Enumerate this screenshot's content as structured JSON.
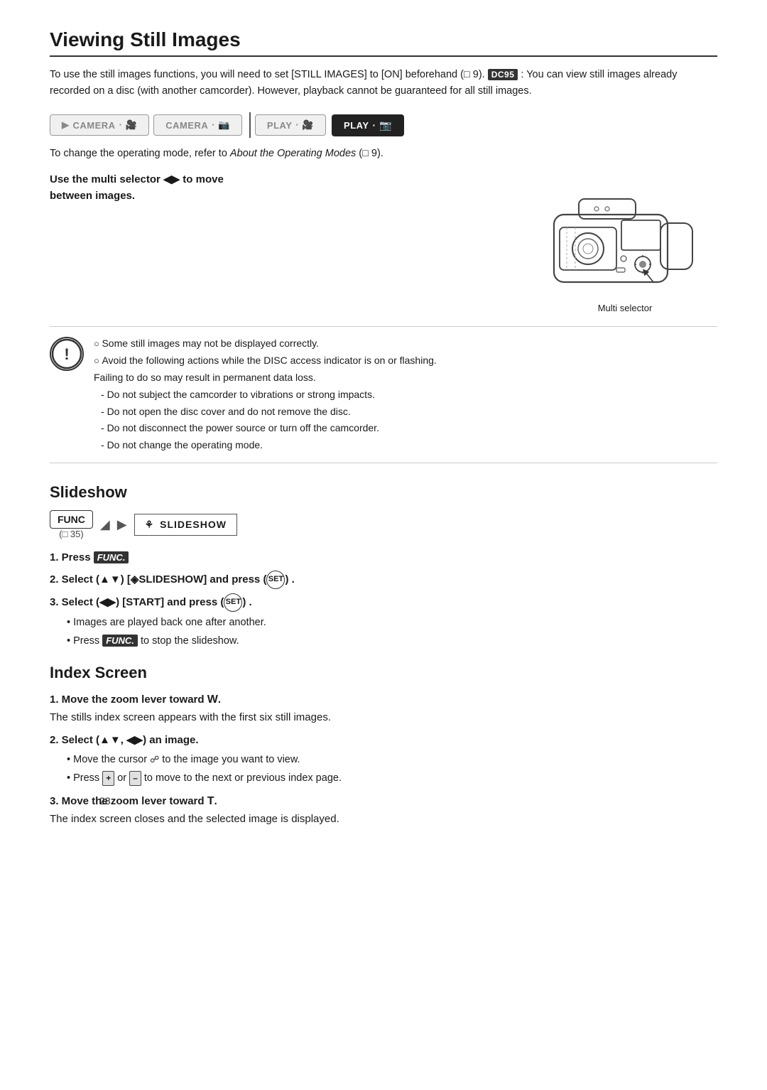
{
  "page": {
    "title": "Viewing Still Images",
    "page_number": "28"
  },
  "intro": {
    "text1": "To use the still images functions, you will need to set [STILL IMAGES] to [ON] beforehand",
    "ref1": "9",
    "dc95_badge": "DC95",
    "text2": ": You can view still images already recorded on a disc (with another camcorder). However, playback cannot be guaranteed for all still images."
  },
  "mode_buttons": [
    {
      "label": "CAMERA",
      "icon": "🎥",
      "active": false
    },
    {
      "label": "CAMERA",
      "icon": "📷",
      "active": false
    },
    {
      "label": "PLAY",
      "icon": "🎥",
      "active": false
    },
    {
      "label": "PLAY",
      "icon": "📷",
      "active": true
    }
  ],
  "to_change_text": "To change the operating mode, refer to ",
  "to_change_italic": "About the Operating Modes",
  "to_change_ref": " 9",
  "use_multi": {
    "line1": "Use the multi selector ◀▶ to move",
    "line2": "between images."
  },
  "multi_selector_label": "Multi selector",
  "warning": {
    "bullets": [
      "Some still images may not be displayed correctly.",
      "Avoid the following actions while the DISC access indicator is on or flashing. Failing to do so may result in permanent data loss."
    ],
    "sub_items": [
      "Do not subject the camcorder to vibrations or strong impacts.",
      "Do not open the disc cover and do not remove the disc.",
      "Do not disconnect the power source or turn off the camcorder.",
      "Do not change the operating mode."
    ]
  },
  "slideshow": {
    "heading": "Slideshow",
    "func_label": "FUNC",
    "func_ref": "35",
    "slideshow_label": "SLIDESHOW",
    "steps": [
      {
        "num": "1.",
        "text": "Press ",
        "func_text": "FUNC.",
        "rest": ""
      },
      {
        "num": "2.",
        "text": "Select (▲▼) [ ◈SLIDESHOW] and press (",
        "set": "SET",
        "rest": ") ."
      },
      {
        "num": "3.",
        "text": "Select (◀▶) [START] and press (",
        "set": "SET",
        "rest": ") ."
      }
    ],
    "sub_bullets": [
      "Images are played back one after another.",
      "Press FUNC. to stop the slideshow."
    ]
  },
  "index_screen": {
    "heading": "Index Screen",
    "steps": [
      {
        "num": "1.",
        "bold": "Move the zoom lever toward W.",
        "detail": "The stills index screen appears with the first six still images."
      },
      {
        "num": "2.",
        "bold": "Select (▲▼, ◀▶) an image.",
        "sub": [
          "Move the cursor 🖻 to the image you want to view.",
          "Press + or – to move to the next or previous index page."
        ]
      },
      {
        "num": "3.",
        "bold": "Move the zoom lever toward T.",
        "detail": "The index screen closes and the selected image is displayed."
      }
    ]
  }
}
